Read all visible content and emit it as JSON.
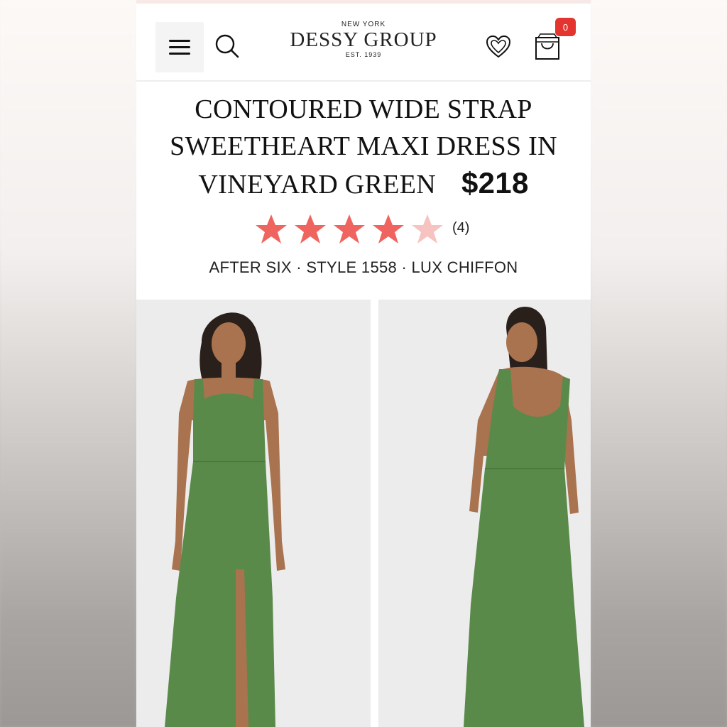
{
  "header": {
    "menu_icon": "hamburger-menu-icon",
    "search_icon": "search-icon",
    "wishlist_icon": "heart-icon",
    "bag_icon": "shopping-bag-icon",
    "cart_count": "0",
    "logo": {
      "top": "NEW YORK",
      "main": "DESSY GROUP",
      "est": "EST. 1939"
    }
  },
  "product": {
    "title": "CONTOURED WIDE STRAP SWEETHEART MAXI DRESS IN VINEYARD GREEN",
    "price": "$218",
    "rating_value": 4,
    "rating_max": 5,
    "rating_count": "(4)",
    "meta": "AFTER SIX · STYLE 1558 · LUX CHIFFON",
    "images": [
      {
        "name": "front-view"
      },
      {
        "name": "back-view"
      }
    ]
  },
  "colors": {
    "star_filled": "#f0645f",
    "star_empty": "#f7c3c1",
    "badge": "#e3342f",
    "dress": "#5a8a4a"
  }
}
